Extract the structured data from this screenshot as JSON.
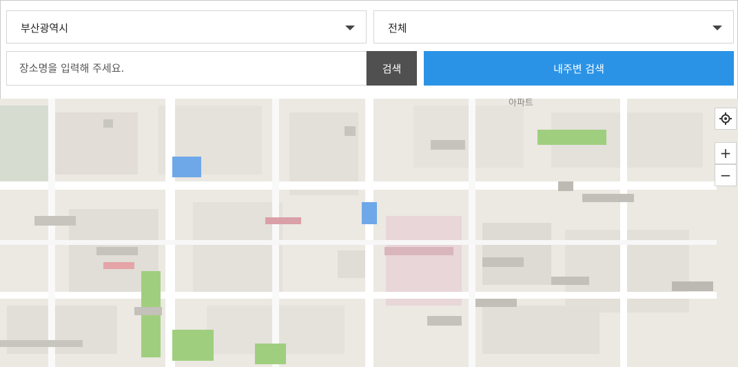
{
  "filters": {
    "region": {
      "selected": "부산광역시"
    },
    "district": {
      "selected": "전체"
    }
  },
  "search": {
    "placeholder": "장소명을 입력해 주세요.",
    "button_label": "검색",
    "nearby_button_label": "내주변 검색"
  },
  "map": {
    "controls": {
      "locate_icon": "crosshair-icon",
      "zoom_in_label": "+",
      "zoom_out_label": "−"
    },
    "visible_labels": [
      "아파트"
    ],
    "colors": {
      "background": "#ece8e2",
      "road": "#ffffff",
      "park": "#9fcf7e",
      "marker": "#6fa8e8",
      "highlight": "#d9a0a8"
    }
  },
  "colors": {
    "accent": "#2b93e6",
    "search_button": "#505050"
  }
}
